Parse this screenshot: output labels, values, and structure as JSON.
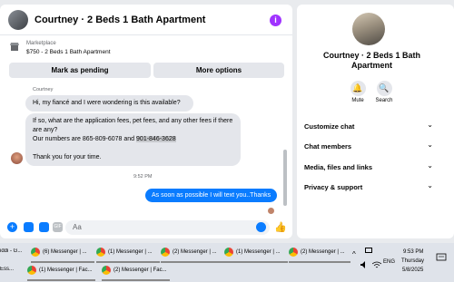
{
  "chat": {
    "title": "Courtney · 2 Beds 1 Bath Apartment",
    "info_icon": "i",
    "marketplace_label": "Marketplace",
    "listing": "$750 - 2 Beds 1 Bath Apartment",
    "mark_pending": "Mark as pending",
    "more_options": "More options",
    "sender": "Courtney",
    "msg1": "Hi, my fiancé and I were wondering is this available?",
    "msg2_line1": "If so, what are the application fees, pet fees, and any other fees if there are any?",
    "msg2_line2a": "Our numbers are 865-809-6078 and ",
    "msg2_highlight": "901-846-3628",
    "msg2_line3": "Thank you for your time.",
    "time": "9:52 PM",
    "my_msg": "As soon as possible I will text you..Thanks",
    "input_placeholder": "Aa",
    "plus": "+",
    "gif": "GIF",
    "like": "👍"
  },
  "side": {
    "name": "Courtney · 2 Beds 1 Bath Apartment",
    "mute_icon": "🔔",
    "mute": "Mute",
    "search_icon": "🔍",
    "search": "Search",
    "sections": [
      "Customize chat",
      "Chat members",
      "Media, files and links",
      "Privacy & support"
    ],
    "chevron": "⌄"
  },
  "taskbar": {
    "items_row1": [
      "iddi - G...",
      "(6) Messenger | ...",
      "(1) Messenger | ...",
      "(2) Messenger | ...",
      "(1) Messenger | ...",
      "(2) Messenger | ..."
    ],
    "items_row2": [
      "(1) Messenger | Fac...",
      "(2) Messenger | Fac..."
    ],
    "row2_prefix": "Ess...",
    "up_arrow": "^",
    "lang": "ENG",
    "time": "9:53 PM",
    "day": "Thursday",
    "date": "5/8/2025"
  },
  "colors": {
    "accent": "#0a7cff",
    "info": "#a033ff"
  }
}
